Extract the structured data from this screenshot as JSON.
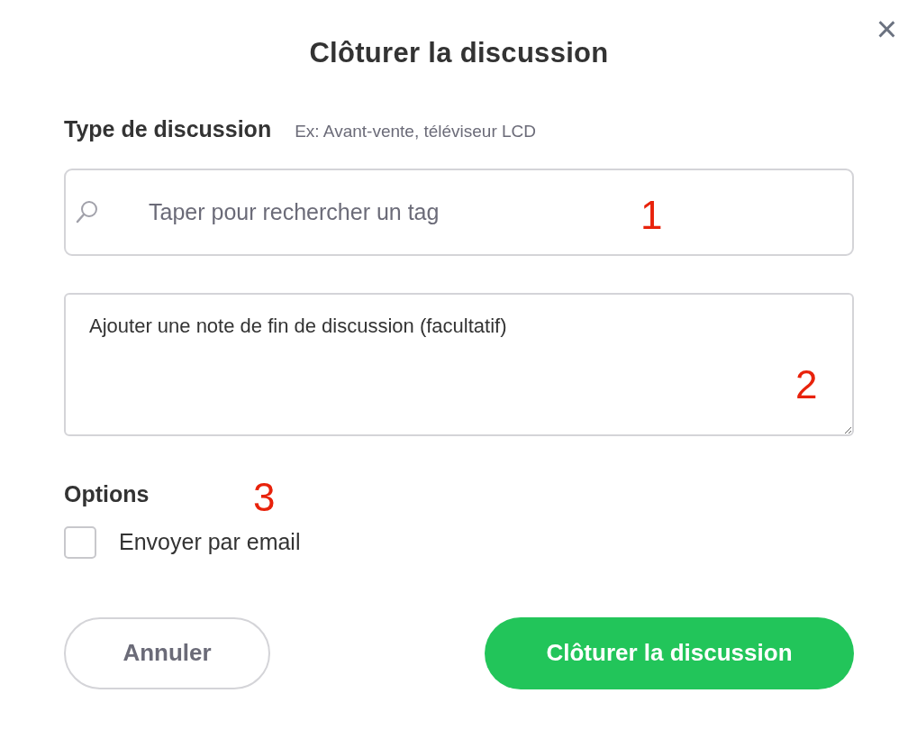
{
  "dialog": {
    "title": "Clôturer la discussion",
    "close": "×"
  },
  "tag_section": {
    "label": "Type de discussion",
    "hint": "Ex: Avant-vente, téléviseur LCD",
    "search": {
      "placeholder": "Taper pour rechercher un tag"
    }
  },
  "note": {
    "placeholder": "Ajouter une note de fin de discussion (facultatif)"
  },
  "options": {
    "label": "Options",
    "items": [
      {
        "label": "Envoyer par email",
        "checked": false
      }
    ]
  },
  "buttons": [
    {
      "label": "Annuler",
      "kind": "secondary"
    },
    {
      "label": "Clôturer la discussion",
      "kind": "primary"
    }
  ],
  "annotations": [
    {
      "text": "1"
    },
    {
      "text": "2"
    },
    {
      "text": "3"
    }
  ]
}
